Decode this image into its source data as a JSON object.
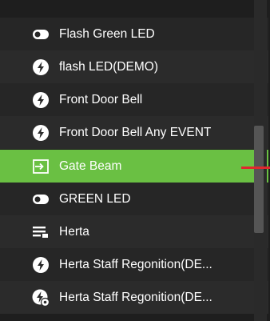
{
  "items": [
    {
      "label": "Flash Green LED",
      "icon": "toggle-icon",
      "selected": false
    },
    {
      "label": "flash LED(DEMO)",
      "icon": "lightning-icon",
      "selected": false
    },
    {
      "label": "Front Door Bell",
      "icon": "lightning-icon",
      "selected": false
    },
    {
      "label": "Front Door Bell Any EVENT",
      "icon": "lightning-icon",
      "selected": false
    },
    {
      "label": "Gate Beam",
      "icon": "input-icon",
      "selected": true
    },
    {
      "label": "GREEN LED",
      "icon": "toggle-icon",
      "selected": false
    },
    {
      "label": "Herta",
      "icon": "list-icon",
      "selected": false
    },
    {
      "label": "Herta Staff Regonition(DE...",
      "icon": "lightning-icon",
      "selected": false
    },
    {
      "label": "Herta Staff Regonition(DE...",
      "icon": "lightning-gear-icon",
      "selected": false
    }
  ],
  "colors": {
    "selected_bg": "#6ac043",
    "marker": "#e0282e"
  }
}
